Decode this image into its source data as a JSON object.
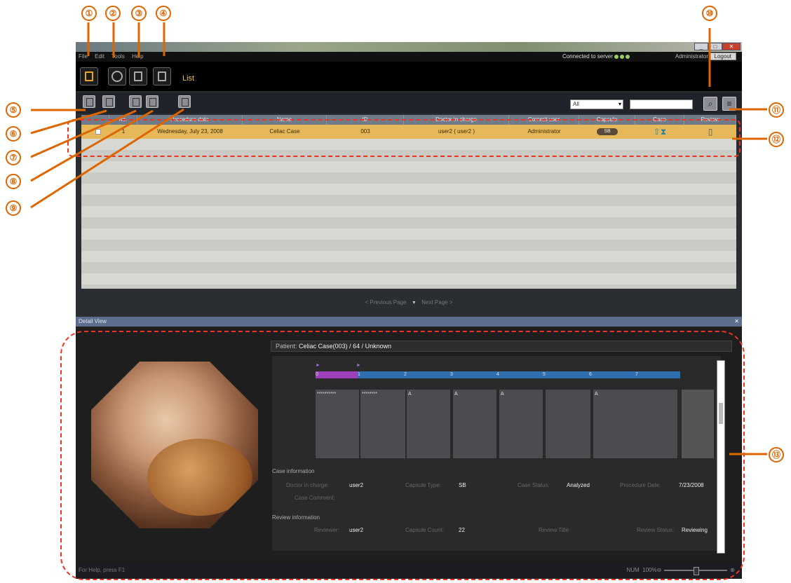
{
  "window": {
    "min": "_",
    "max": "□",
    "close": "✕"
  },
  "menu": [
    "File",
    "Edit",
    "Tools",
    "Help"
  ],
  "connection": {
    "text": "Connected to server"
  },
  "user": {
    "name": "Administrator",
    "logout": "Logout"
  },
  "toolbar": {
    "view_label": "List"
  },
  "filter": {
    "selected": "All",
    "search_value": ""
  },
  "table": {
    "columns": [
      "",
      "No.",
      "Procedure date",
      "Name",
      "ID",
      "Doctor in charge",
      "Commit user",
      "Capsule",
      "Case",
      "Review"
    ],
    "rows": [
      {
        "no": "1",
        "date": "Wednesday, July 23, 2008",
        "name": "Celiac Case",
        "id": "003",
        "doctor": "user2 ( user2 )",
        "commit": "Administrator",
        "capsule": "SB"
      }
    ]
  },
  "pager": {
    "prev": "< Previous Page",
    "next": "Next Page >"
  },
  "detail": {
    "title": "Detail View",
    "patient_label": "Patient:",
    "patient_value": "Celiac Case(003) / 64 / Unknown",
    "segments": [
      "0",
      "1",
      "2",
      "3",
      "4",
      "5",
      "6",
      "7"
    ],
    "cell_labels": [
      "**********",
      "********",
      "A",
      "A",
      "A",
      "",
      "A",
      "",
      ""
    ],
    "case_info": "Case information",
    "doctor_label": "Doctor in charge:",
    "doctor_value": "user2",
    "capsule_label": "Capsule Type:",
    "capsule_value": "SB",
    "status_label": "Case Status:",
    "status_value": "Analyzed",
    "procdate_label": "Procedure Date:",
    "procdate_value": "7/23/2008",
    "comment_label": "Case Comment:",
    "review_info": "Review information",
    "reviewer_label": "Reviewer:",
    "reviewer_value": "user2",
    "count_label": "Capsule Count:",
    "count_value": "22",
    "rtitle_label": "Review Title",
    "rstatus_label": "Review Status:",
    "rstatus_value": "Reviewing"
  },
  "status": {
    "help": "For Help, press F1",
    "mode": "NUM",
    "zoom": "100%"
  },
  "callouts": [
    "①",
    "②",
    "③",
    "④",
    "⑤",
    "⑥",
    "⑦",
    "⑧",
    "⑨",
    "⑩",
    "⑪",
    "⑫",
    "⑬"
  ]
}
